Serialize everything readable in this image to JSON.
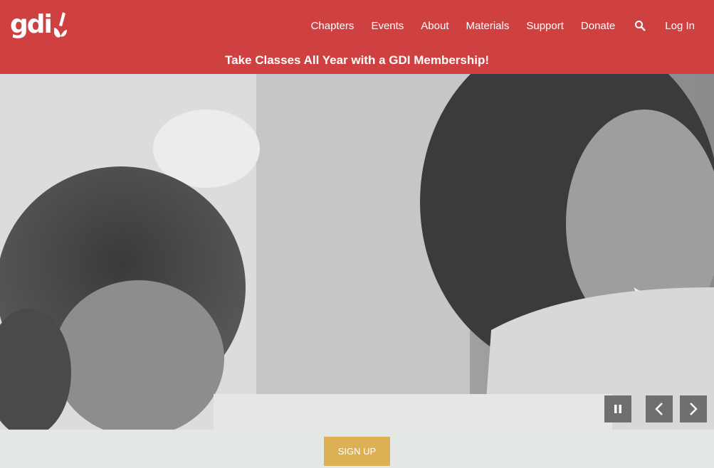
{
  "brand": {
    "name": "gdi",
    "color": "#cf4141",
    "accent": "#ddb153"
  },
  "nav": {
    "items": [
      "Chapters",
      "Events",
      "About",
      "Materials",
      "Support",
      "Donate"
    ],
    "search_icon": "search-icon",
    "login_label": "Log In"
  },
  "promo": {
    "text": "Take Classes All Year with a GDI Membership!"
  },
  "hero": {
    "controls": {
      "pause_icon": "pause-icon",
      "prev_icon": "chevron-left-icon",
      "next_icon": "chevron-right-icon"
    }
  },
  "cta": {
    "signup_label": "SIGN UP"
  }
}
